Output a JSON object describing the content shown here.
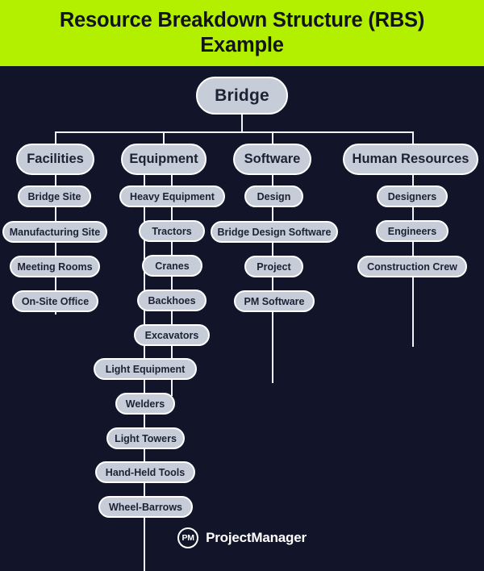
{
  "header": {
    "title": "Resource Breakdown Structure (RBS) Example",
    "background_color": "#b2f000",
    "text_color": "#13131c"
  },
  "theme": {
    "page_background": "#12152a",
    "node_fill": "#c6ccd8",
    "node_border": "#ffffff",
    "node_text": "#1c2233",
    "connector": "#f0f3f7"
  },
  "chart_data": {
    "type": "diagram",
    "diagram_type": "tree",
    "title": "Resource Breakdown Structure (RBS) Example",
    "root": "Bridge",
    "branches": [
      {
        "name": "Facilities",
        "children": [
          "Bridge Site",
          "Manufacturing Site",
          "Meeting Rooms",
          "On-Site Office"
        ]
      },
      {
        "name": "Equipment",
        "children": [
          "Heavy Equipment",
          "Tractors",
          "Cranes",
          "Backhoes",
          "Excavators",
          "Light Equipment",
          "Welders",
          "Light Towers",
          "Hand-Held Tools",
          "Wheel-Barrows"
        ]
      },
      {
        "name": "Software",
        "children": [
          "Design",
          "Bridge Design Software",
          "Project",
          "PM Software"
        ]
      },
      {
        "name": "Human Resources",
        "children": [
          "Designers",
          "Engineers",
          "Construction Crew"
        ]
      }
    ]
  },
  "nodes": {
    "root": "Bridge",
    "facilities": "Facilities",
    "equipment": "Equipment",
    "software": "Software",
    "human_resources": "Human Resources",
    "bridge_site": "Bridge Site",
    "manufacturing_site": "Manufacturing Site",
    "meeting_rooms": "Meeting Rooms",
    "on_site_office": "On-Site Office",
    "heavy_equipment": "Heavy Equipment",
    "tractors": "Tractors",
    "cranes": "Cranes",
    "backhoes": "Backhoes",
    "excavators": "Excavators",
    "light_equipment": "Light Equipment",
    "welders": "Welders",
    "light_towers": "Light Towers",
    "hand_held_tools": "Hand-Held Tools",
    "wheel_barrows": "Wheel-Barrows",
    "design": "Design",
    "bridge_design_software": "Bridge Design Software",
    "project": "Project",
    "pm_software": "PM Software",
    "designers": "Designers",
    "engineers": "Engineers",
    "construction_crew": "Construction Crew"
  },
  "footer": {
    "badge_text": "PM",
    "brand": "ProjectManager"
  }
}
